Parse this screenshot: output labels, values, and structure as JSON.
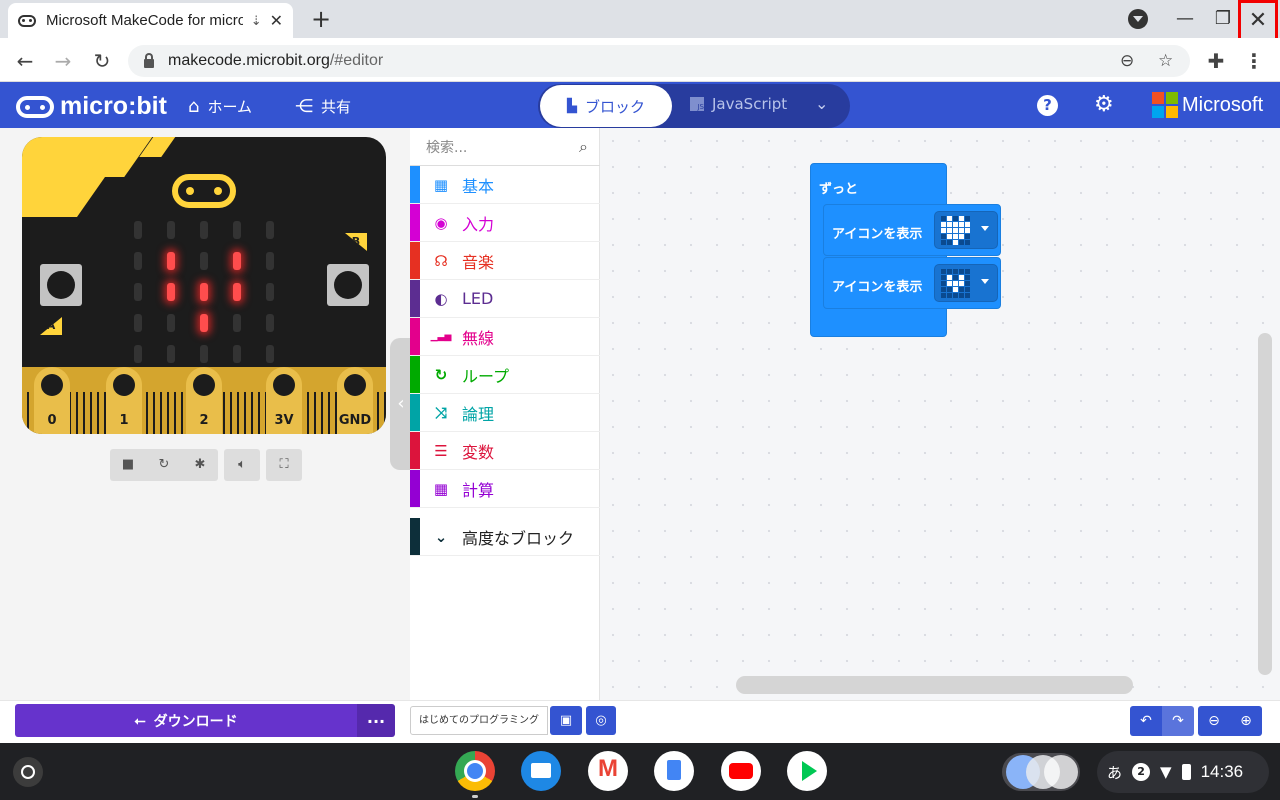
{
  "browser": {
    "tab_title": "Microsoft MakeCode for micro:bit",
    "tab_close": "✕",
    "new_tab": "+",
    "url_host": "makecode.microbit.org",
    "url_path": "/#editor",
    "min": "—",
    "max": "❐",
    "close": "✕"
  },
  "header": {
    "logo_text": "micro:bit",
    "home_label": "ホーム",
    "share_label": "共有",
    "blocks_tab": "ブロック",
    "js_tab": "JavaScript",
    "microsoft_label": "Microsoft",
    "ms_colors": [
      "#f25022",
      "#7fba00",
      "#00a4ef",
      "#ffb900"
    ]
  },
  "simulator": {
    "button_a": "A",
    "button_b": "B",
    "pins": [
      "0",
      "1",
      "2",
      "3V",
      "GND"
    ],
    "led_matrix": [
      [
        0,
        0,
        0,
        0,
        0
      ],
      [
        0,
        1,
        0,
        1,
        0
      ],
      [
        0,
        1,
        1,
        1,
        0
      ],
      [
        0,
        0,
        1,
        0,
        0
      ],
      [
        0,
        0,
        0,
        0,
        0
      ]
    ]
  },
  "toolbox": {
    "search_placeholder": "検索...",
    "categories": [
      {
        "label": "基本",
        "color": "#1e90ff",
        "icon": "grid-icon",
        "glyph": "▦"
      },
      {
        "label": "入力",
        "color": "#d400d4",
        "icon": "target-icon",
        "glyph": "◉"
      },
      {
        "label": "音楽",
        "color": "#e63022",
        "icon": "headphones-icon",
        "glyph": "☊"
      },
      {
        "label": "LED",
        "color": "#5c2d91",
        "icon": "toggle-icon",
        "glyph": "◐"
      },
      {
        "label": "無線",
        "color": "#e3008c",
        "icon": "signal-icon",
        "glyph": "▁▃▅"
      },
      {
        "label": "ループ",
        "color": "#00aa00",
        "icon": "loop-icon",
        "glyph": "↻"
      },
      {
        "label": "論理",
        "color": "#00a4a6",
        "icon": "shuffle-icon",
        "glyph": "⤨"
      },
      {
        "label": "変数",
        "color": "#dc143c",
        "icon": "list-icon",
        "glyph": "☰"
      },
      {
        "label": "計算",
        "color": "#9400d3",
        "icon": "calculator-icon",
        "glyph": "▦"
      },
      {
        "label": "高度なブロック",
        "color": "#0d2f3a",
        "icon": "chevron-down-icon",
        "glyph": "⌄"
      }
    ]
  },
  "workspace": {
    "forever_label": "ずっと",
    "show_icon_label": "アイコンを表示",
    "icon1": [
      [
        0,
        1,
        0,
        1,
        0
      ],
      [
        1,
        1,
        1,
        1,
        1
      ],
      [
        1,
        1,
        1,
        1,
        1
      ],
      [
        0,
        1,
        1,
        1,
        0
      ],
      [
        0,
        0,
        1,
        0,
        0
      ]
    ],
    "icon2": [
      [
        0,
        0,
        0,
        0,
        0
      ],
      [
        0,
        1,
        0,
        1,
        0
      ],
      [
        0,
        1,
        1,
        1,
        0
      ],
      [
        0,
        0,
        1,
        0,
        0
      ],
      [
        0,
        0,
        0,
        0,
        0
      ]
    ]
  },
  "bottom": {
    "download_label": "ダウンロード",
    "more_label": "...",
    "project_name": "はじめてのプログラミング"
  },
  "shelf": {
    "ime": "あ",
    "notifications": "2",
    "time": "14:36"
  }
}
